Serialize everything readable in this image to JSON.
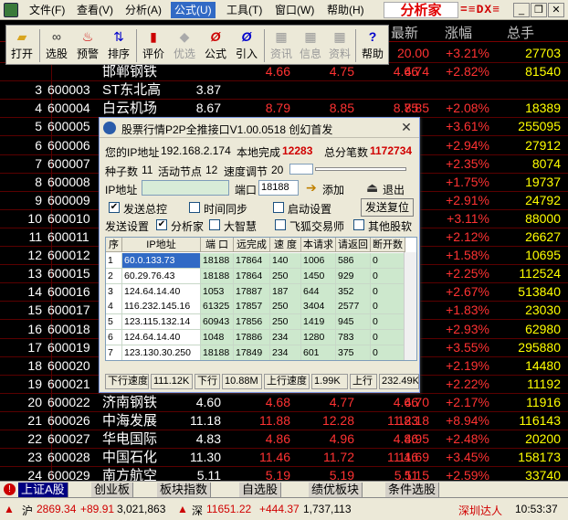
{
  "menu": {
    "items": [
      "文件(F)",
      "查看(V)",
      "分析(A)",
      "公式(U)",
      "工具(T)",
      "窗口(W)",
      "帮助(H)"
    ],
    "brand": "分析家",
    "logo": "=≡DX≡"
  },
  "toolbar": {
    "buttons": [
      "打开",
      "选股",
      "预警",
      "排序",
      "评价",
      "优选",
      "公式",
      "引入",
      "资讯",
      "信息",
      "资料",
      "帮助"
    ],
    "disabled": [
      "优选",
      "资讯",
      "信息",
      "资料"
    ]
  },
  "grid": {
    "headers": {
      "last": "最新",
      "change": "涨幅",
      "hands": "总手"
    },
    "rows": [
      {
        "idx": "",
        "code": "",
        "name": "",
        "price": "",
        "a": "",
        "b": "",
        "c": "",
        "d": "20.00",
        "e": "+3.21%",
        "f": "27703"
      },
      {
        "idx": "",
        "code": "",
        "name": "邯郸钢铁",
        "price": "",
        "a": "4.66",
        "b": "4.75",
        "c": "4.66",
        "d": "4.74",
        "e": "+2.82%",
        "f": "81540"
      },
      {
        "idx": "3",
        "code": "600003",
        "name": "ST东北高",
        "price": "3.87",
        "a": "",
        "b": "",
        "c": "",
        "d": "",
        "e": "",
        "f": ""
      },
      {
        "idx": "4",
        "code": "600004",
        "name": "白云机场",
        "price": "8.67",
        "a": "8.79",
        "b": "8.85",
        "c": "8.75",
        "d": "8.85",
        "e": "+2.08%",
        "f": "18389"
      },
      {
        "idx": "5",
        "code": "600005",
        "name": "",
        "price": "",
        "a": "",
        "b": "",
        "c": "",
        "d": "",
        "e": "+3.61%",
        "f": "255095"
      },
      {
        "idx": "6",
        "code": "600006",
        "name": "",
        "price": "",
        "a": "",
        "b": "",
        "c": "",
        "d": "",
        "e": "+2.94%",
        "f": "27912"
      },
      {
        "idx": "7",
        "code": "600007",
        "name": "",
        "price": "",
        "a": "",
        "b": "",
        "c": "",
        "d": "",
        "e": "+2.35%",
        "f": "8074"
      },
      {
        "idx": "8",
        "code": "600008",
        "name": "",
        "price": "",
        "a": "",
        "b": "",
        "c": "",
        "d": "",
        "e": "+1.75%",
        "f": "19737"
      },
      {
        "idx": "9",
        "code": "600009",
        "name": "",
        "price": "",
        "a": "",
        "b": "",
        "c": "",
        "d": "",
        "e": "+2.91%",
        "f": "24792"
      },
      {
        "idx": "10",
        "code": "600010",
        "name": "",
        "price": "",
        "a": "",
        "b": "",
        "c": "",
        "d": "",
        "e": "+3.11%",
        "f": "88000"
      },
      {
        "idx": "11",
        "code": "600011",
        "name": "",
        "price": "",
        "a": "",
        "b": "",
        "c": "",
        "d": "",
        "e": "+2.12%",
        "f": "26627"
      },
      {
        "idx": "12",
        "code": "600012",
        "name": "",
        "price": "",
        "a": "",
        "b": "",
        "c": "",
        "d": "",
        "e": "+1.58%",
        "f": "10695"
      },
      {
        "idx": "13",
        "code": "600015",
        "name": "",
        "price": "",
        "a": "",
        "b": "",
        "c": "",
        "d": "",
        "e": "+2.25%",
        "f": "112524"
      },
      {
        "idx": "14",
        "code": "600016",
        "name": "",
        "price": "",
        "a": "",
        "b": "",
        "c": "",
        "d": "",
        "e": "+2.67%",
        "f": "513840"
      },
      {
        "idx": "15",
        "code": "600017",
        "name": "",
        "price": "",
        "a": "",
        "b": "",
        "c": "",
        "d": "",
        "e": "+1.83%",
        "f": "23030"
      },
      {
        "idx": "16",
        "code": "600018",
        "name": "",
        "price": "",
        "a": "",
        "b": "",
        "c": "",
        "d": "",
        "e": "+2.93%",
        "f": "62980"
      },
      {
        "idx": "17",
        "code": "600019",
        "name": "",
        "price": "",
        "a": "",
        "b": "",
        "c": "",
        "d": "",
        "e": "+3.55%",
        "f": "295880"
      },
      {
        "idx": "18",
        "code": "600020",
        "name": "",
        "price": "",
        "a": "",
        "b": "",
        "c": "",
        "d": "",
        "e": "+2.19%",
        "f": "14480"
      },
      {
        "idx": "19",
        "code": "600021",
        "name": "",
        "price": "",
        "a": "",
        "b": "",
        "c": "",
        "d": "",
        "e": "+2.22%",
        "f": "11192"
      },
      {
        "idx": "20",
        "code": "600022",
        "name": "济南钢铁",
        "price": "4.60",
        "a": "4.68",
        "b": "4.77",
        "c": "4.66",
        "d": "4.70",
        "e": "+2.17%",
        "f": "11916"
      },
      {
        "idx": "21",
        "code": "600026",
        "name": "中海发展",
        "price": "11.18",
        "a": "11.88",
        "b": "12.28",
        "c": "11.83",
        "d": "12.18",
        "e": "+8.94%",
        "f": "116143"
      },
      {
        "idx": "22",
        "code": "600027",
        "name": "华电国际",
        "price": "4.83",
        "a": "4.86",
        "b": "4.96",
        "c": "4.86",
        "d": "4.95",
        "e": "+2.48%",
        "f": "20200"
      },
      {
        "idx": "23",
        "code": "600028",
        "name": "中国石化",
        "price": "11.30",
        "a": "11.46",
        "b": "11.72",
        "c": "11.46",
        "d": "11.69",
        "e": "+3.45%",
        "f": "158173"
      },
      {
        "idx": "24",
        "code": "600029",
        "name": "南方航空",
        "price": "5.11",
        "a": "5.19",
        "b": "5.19",
        "c": "5.11",
        "d": "5.15",
        "e": "+2.59%",
        "f": "33740"
      }
    ]
  },
  "dialog": {
    "title": "股票行情P2P全推接口V1.00.0518 创幻首发",
    "ip_label": "您的IP地址",
    "ip_value": "192.168.2.174",
    "local_done_label": "本地完成",
    "local_done_value": "12283",
    "total_label": "总分笔数",
    "total_value": "1172734",
    "seed_label": "种子数",
    "seed_value": "11",
    "active_label": "活动节点",
    "active_value": "12",
    "speed_label": "速度调节",
    "speed_value": "20",
    "ipaddr_label": "IP地址",
    "port_label": "端口",
    "port_value": "18188",
    "add_label": "添加",
    "exit_label": "退出",
    "send_total": "发送总控",
    "time_sync": "时间同步",
    "startup": "启动设置",
    "send_reset": "发送复位",
    "send_settings": "发送设置",
    "opt_analyst": "分析家",
    "opt_dzh": "大智慧",
    "opt_fh": "飞狐交易师",
    "opt_other": "其他股软",
    "table": {
      "columns": [
        "序",
        "IP地址",
        "端 口",
        "远完成",
        "速 度",
        "本请求",
        "请返回",
        "断开数"
      ],
      "rows": [
        [
          "1",
          "60.0.133.73",
          "18188",
          "17864",
          "140",
          "1006",
          "586",
          "0"
        ],
        [
          "2",
          "60.29.76.43",
          "18188",
          "17864",
          "250",
          "1450",
          "929",
          "0"
        ],
        [
          "3",
          "124.64.14.40",
          "1053",
          "17887",
          "187",
          "644",
          "352",
          "0"
        ],
        [
          "4",
          "116.232.145.16",
          "61325",
          "17857",
          "250",
          "3404",
          "2577",
          "0"
        ],
        [
          "5",
          "123.115.132.14",
          "60943",
          "17856",
          "250",
          "1419",
          "945",
          "0"
        ],
        [
          "6",
          "124.64.14.40",
          "1048",
          "17886",
          "234",
          "1280",
          "783",
          "0"
        ],
        [
          "7",
          "123.130.30.250",
          "18188",
          "17849",
          "234",
          "601",
          "375",
          "0"
        ]
      ]
    },
    "status": {
      "up_speed_label": "下行速度",
      "up_speed_value": "111.12K",
      "down_label": "下行",
      "down_value": "10.88M",
      "upspeed2_label": "上行速度",
      "upspeed2_value": "1.99K",
      "up_label": "上行",
      "up_value": "232.49K"
    }
  },
  "tabs": [
    "上证A股",
    "创业板",
    "板块指数",
    "自选股",
    "绩优板块",
    "条件选股"
  ],
  "statusbar": {
    "sh_label": "沪",
    "sh_index": "2869.34",
    "sh_change": "+89.91",
    "sh_vol": "3,021,863",
    "sz_label": "深",
    "sz_index": "11651.22",
    "sz_change": "+444.37",
    "sz_vol": "1,737,113",
    "tech": "深圳达人",
    "time": "10:53:37"
  }
}
